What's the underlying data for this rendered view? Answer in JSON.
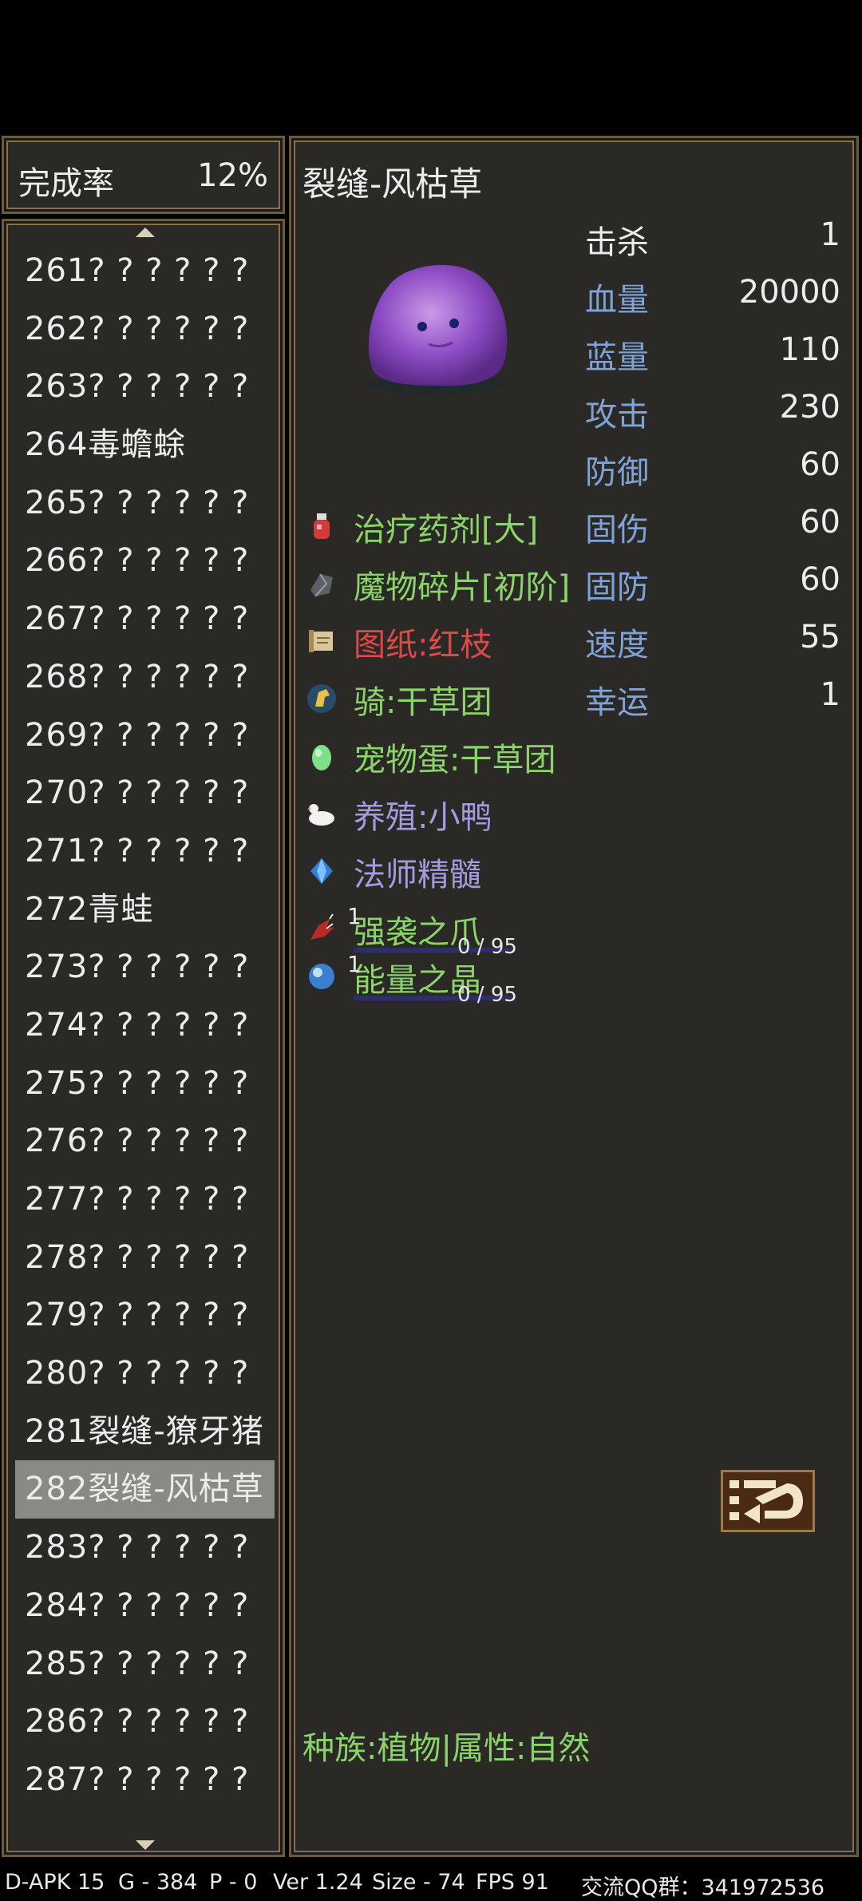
{
  "completion": {
    "label": "完成率",
    "value": "12%"
  },
  "list": [
    {
      "label": "261? ? ? ? ? ?"
    },
    {
      "label": "262? ? ? ? ? ?"
    },
    {
      "label": "263? ? ? ? ? ?"
    },
    {
      "label": "264毒蟾蜍"
    },
    {
      "label": "265? ? ? ? ? ?"
    },
    {
      "label": "266? ? ? ? ? ?"
    },
    {
      "label": "267? ? ? ? ? ?"
    },
    {
      "label": "268? ? ? ? ? ?"
    },
    {
      "label": "269? ? ? ? ? ?"
    },
    {
      "label": "270? ? ? ? ? ?"
    },
    {
      "label": "271? ? ? ? ? ?"
    },
    {
      "label": "272青蛙"
    },
    {
      "label": "273? ? ? ? ? ?"
    },
    {
      "label": "274? ? ? ? ? ?"
    },
    {
      "label": "275? ? ? ? ? ?"
    },
    {
      "label": "276? ? ? ? ? ?"
    },
    {
      "label": "277? ? ? ? ? ?"
    },
    {
      "label": "278? ? ? ? ? ?"
    },
    {
      "label": "279? ? ? ? ? ?"
    },
    {
      "label": "280? ? ? ? ? ?"
    },
    {
      "label": "281裂缝-獠牙猪"
    },
    {
      "label": "282裂缝-风枯草"
    },
    {
      "label": "283? ? ? ? ? ?"
    },
    {
      "label": "284? ? ? ? ? ?"
    },
    {
      "label": "285? ? ? ? ? ?"
    },
    {
      "label": "286? ? ? ? ? ?"
    },
    {
      "label": "287? ? ? ? ? ?"
    }
  ],
  "detail": {
    "title": "裂缝-风枯草",
    "stats": [
      {
        "label": "击杀",
        "value": "1"
      },
      {
        "label": "血量",
        "value": "20000"
      },
      {
        "label": "蓝量",
        "value": "110"
      },
      {
        "label": "攻击",
        "value": "230"
      },
      {
        "label": "防御",
        "value": "60"
      },
      {
        "label": "固伤",
        "value": "60"
      },
      {
        "label": "固防",
        "value": "60"
      },
      {
        "label": "速度",
        "value": "55"
      },
      {
        "label": "幸运",
        "value": "1"
      }
    ],
    "drops": [
      {
        "label": "治疗药剂[大]",
        "icon": "potion-icon",
        "color": "#8bd46a"
      },
      {
        "label": "魔物碎片[初阶]",
        "icon": "shard-icon",
        "color": "#8bd46a"
      },
      {
        "label": "图纸:红枝",
        "icon": "scroll-icon",
        "color": "#e04848"
      },
      {
        "label": "骑:干草团",
        "icon": "horse-icon",
        "color": "#8bd46a"
      },
      {
        "label": "宠物蛋:干草团",
        "icon": "egg-icon",
        "color": "#8bd46a"
      },
      {
        "label": "养殖:小鸭",
        "icon": "duck-icon",
        "color": "#a39ce0"
      },
      {
        "label": "法师精髓",
        "icon": "gem-icon",
        "color": "#a39ce0"
      },
      {
        "label": "强袭之爪",
        "icon": "claw-icon",
        "color": "#8bd46a",
        "progress": "0 / 95",
        "mark": "1"
      },
      {
        "label": "能量之晶",
        "icon": "orb-icon",
        "color": "#8bd46a",
        "progress": "0 / 95",
        "mark": "1"
      }
    ],
    "race": "种族:植物|属性:自然"
  },
  "status_bar": {
    "apk": "D-APK 15",
    "g": "G - 384",
    "p": "P - 0",
    "ver": "Ver 1.24",
    "size": "Size - 74",
    "fps": "FPS 91",
    "qq": "交流QQ群：341972536"
  }
}
